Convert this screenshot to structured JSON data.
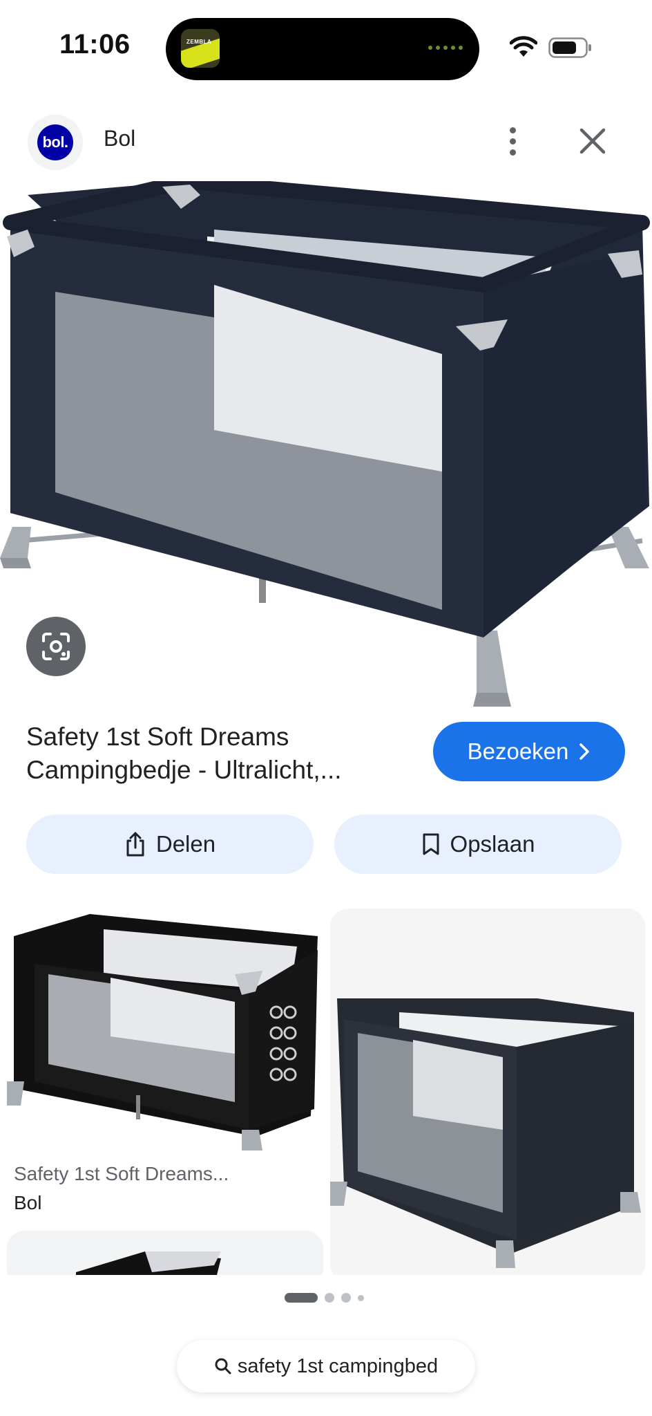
{
  "status_bar": {
    "time": "11:06",
    "now_playing_art_text": "ZEMBLA"
  },
  "header": {
    "site_name": "Bol",
    "logo_text": "bol."
  },
  "product": {
    "title": "Safety 1st Soft Dreams Campingbedje - Ultralicht,...",
    "visit_label": "Bezoeken",
    "share_label": "Delen",
    "save_label": "Opslaan"
  },
  "related": [
    {
      "title": "Safety 1st Soft Dreams...",
      "source": "Bol"
    }
  ],
  "search": {
    "query": "safety 1st campingbed"
  },
  "icons": [
    "wifi-icon",
    "battery-icon",
    "more-vert-icon",
    "close-icon",
    "lens-icon",
    "chevron-right-icon",
    "share-icon",
    "bookmark-icon",
    "search-icon"
  ],
  "colors": {
    "accent": "#1a73e8",
    "pill_bg": "#e8f0fe",
    "crib_fabric": "#252c3d",
    "bol_blue": "#0000a4"
  }
}
